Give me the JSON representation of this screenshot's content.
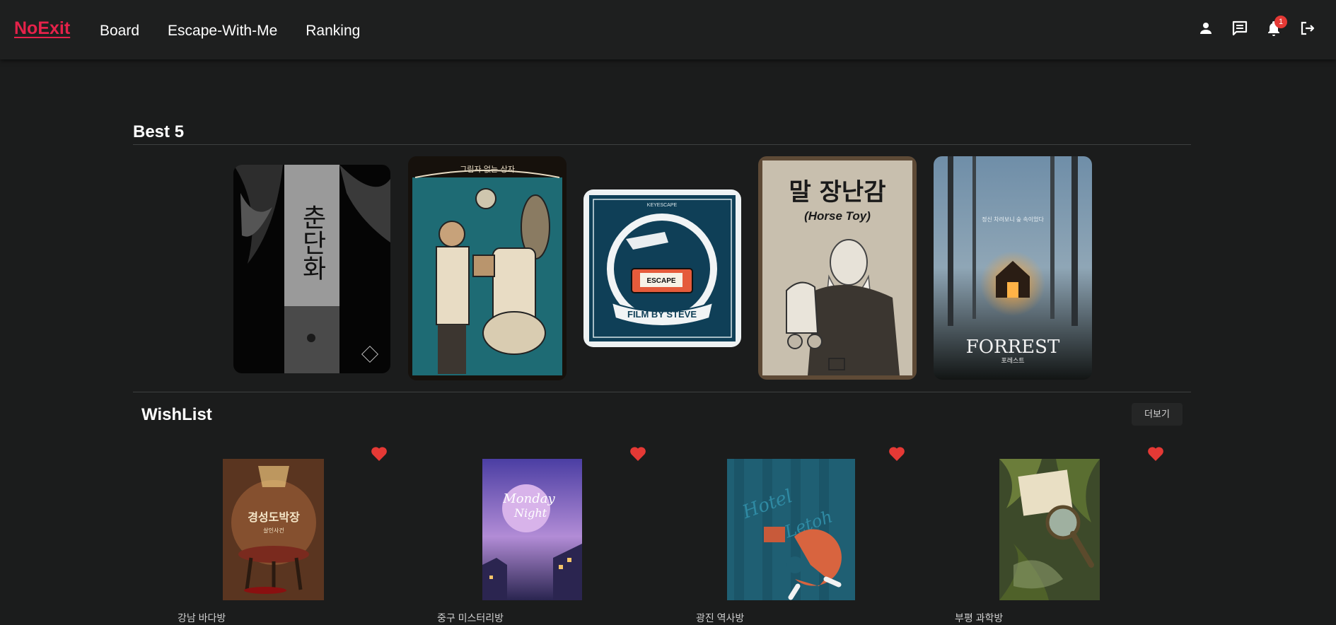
{
  "nav": {
    "brand": "NoExit",
    "links": [
      "Board",
      "Escape-With-Me",
      "Ranking"
    ],
    "icons": [
      "user-icon",
      "chat-icon",
      "bell-icon",
      "logout-icon"
    ],
    "notification_count": "1"
  },
  "best": {
    "title": "Best 5",
    "posters": [
      {
        "title": "춘단화"
      },
      {
        "title": "그림자 없는 상자"
      },
      {
        "title": "FILM BY STEVE",
        "brand": "KEYESCAPE",
        "tape_label": "ESCAPE"
      },
      {
        "title": "말 장난감",
        "subtitle": "(Horse Toy)"
      },
      {
        "title": "FORREST",
        "subtitle": "포레스트"
      }
    ]
  },
  "wishlist": {
    "title": "WishList",
    "more_label": "더보기",
    "items": [
      {
        "label": "강남 바다방",
        "poster_title": "경성도박장",
        "poster_subtitle": "살인사건"
      },
      {
        "label": "중구 미스터리방",
        "poster_title": "Monday",
        "poster_subtitle": "Night"
      },
      {
        "label": "광진 역사방",
        "poster_title": "Hotel",
        "poster_subtitle": "Letoh"
      },
      {
        "label": "부평 과학방",
        "poster_title": "",
        "poster_subtitle": ""
      }
    ]
  },
  "colors": {
    "background": "#1b1c1c",
    "brand": "#e5224a",
    "heart": "#e53935"
  }
}
